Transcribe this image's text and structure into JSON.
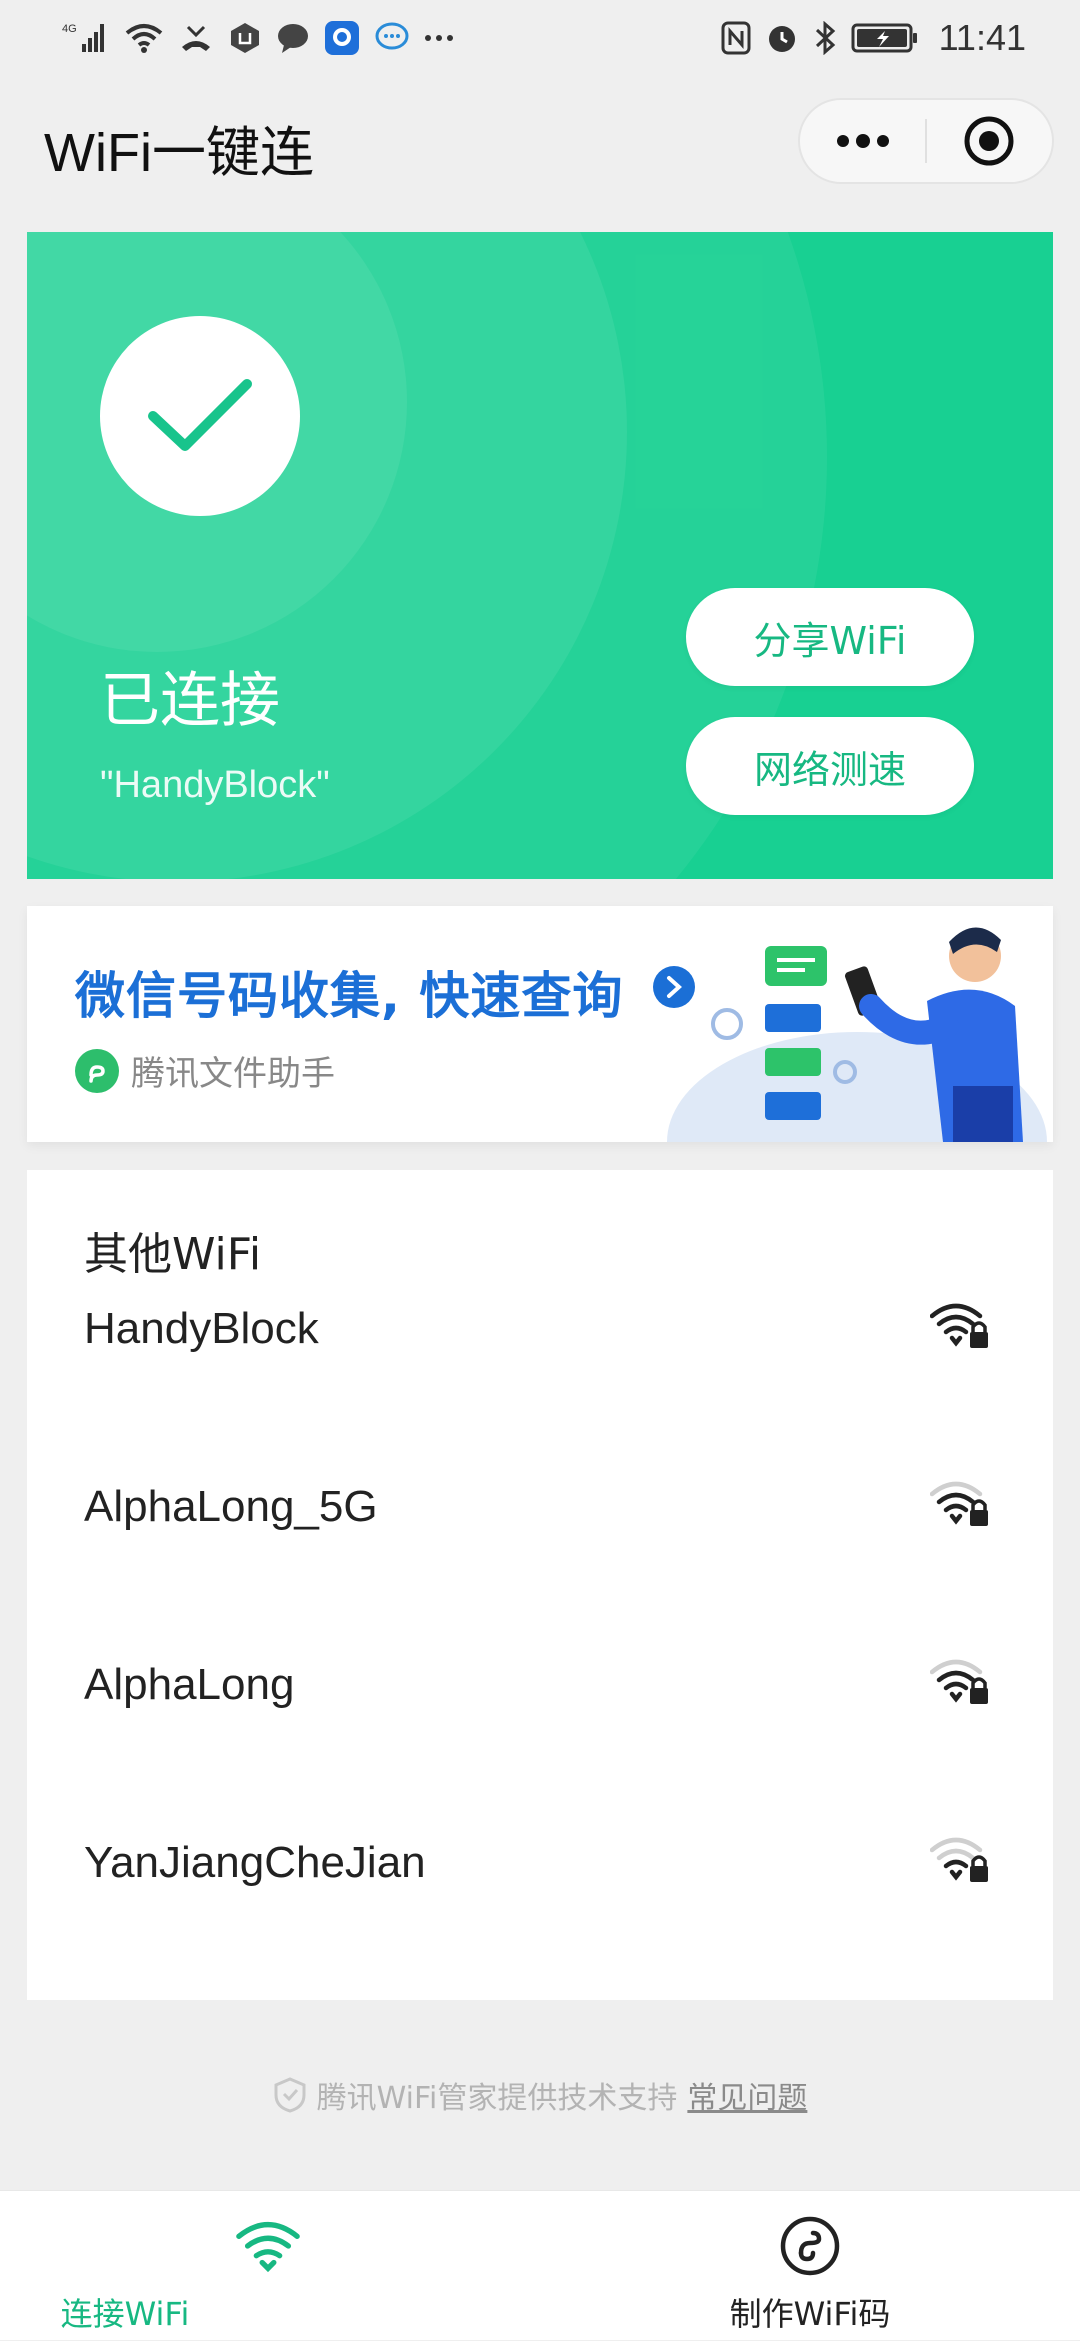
{
  "status_bar": {
    "network": "4G",
    "time": "11:41",
    "icons": [
      "signal-icon",
      "wifi-icon",
      "missed-call-icon",
      "shield-icon",
      "message-icon",
      "app-icon",
      "chat-icon",
      "more-icon",
      "nfc-icon",
      "alarm-icon",
      "bluetooth-icon",
      "battery-icon"
    ]
  },
  "header": {
    "title": "WiFi一键连",
    "capsule": {
      "more": "more-dots-icon",
      "close": "target-icon"
    }
  },
  "hero": {
    "status": "已连接",
    "ssid": "\"HandyBlock\"",
    "share_button": "分享WiFi",
    "speed_button": "网络测速",
    "accent": "#18d092"
  },
  "ad": {
    "title": "微信号码收集, 快速查询",
    "sub": "腾讯文件助手",
    "title_color": "#1b6fd6"
  },
  "wifi_list": {
    "header": "其他WiFi",
    "items": [
      {
        "name": "HandyBlock",
        "icon": "wifi-lock-icon",
        "strength": 1.0
      },
      {
        "name": "AlphaLong_5G",
        "icon": "wifi-lock-icon",
        "strength": 0.75
      },
      {
        "name": "AlphaLong",
        "icon": "wifi-lock-icon",
        "strength": 0.75
      },
      {
        "name": "YanJiangCheJian",
        "icon": "wifi-lock-icon",
        "strength": 0.5
      }
    ]
  },
  "footer": {
    "text": "腾讯WiFi管家提供技术支持",
    "link": "常见问题"
  },
  "tabs": [
    {
      "label": "连接WiFi",
      "icon": "wifi-icon",
      "active": true
    },
    {
      "label": "制作WiFi码",
      "icon": "link-icon",
      "active": false
    }
  ]
}
